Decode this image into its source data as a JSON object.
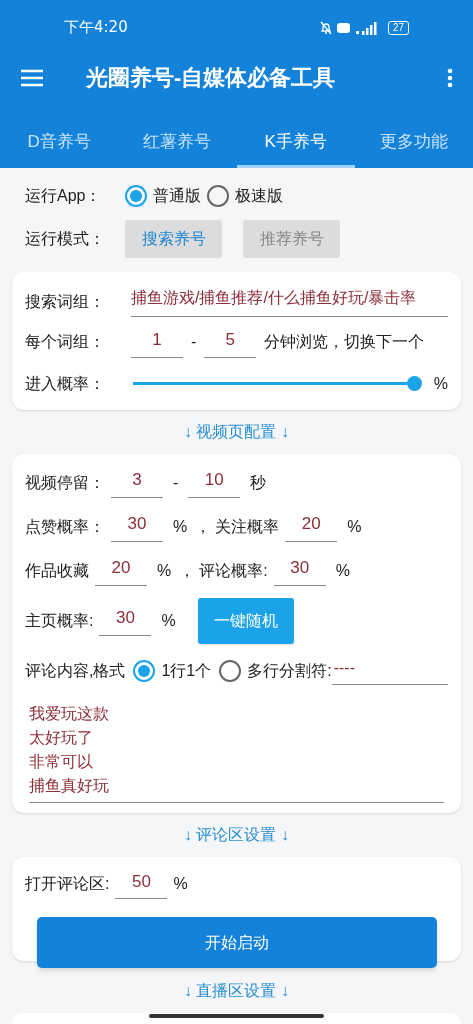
{
  "status_bar": {
    "time": "下午4:20",
    "battery": "27"
  },
  "app_bar": {
    "title": "光圈养号-自媒体必备工具"
  },
  "tabs": [
    {
      "label": "D音养号",
      "selected": false
    },
    {
      "label": "红薯养号",
      "selected": false
    },
    {
      "label": "K手养号",
      "selected": true
    },
    {
      "label": "更多功能",
      "selected": false
    }
  ],
  "run_app": {
    "label": "运行App：",
    "options": [
      {
        "label": "普通版",
        "selected": true
      },
      {
        "label": "极速版",
        "selected": false
      }
    ]
  },
  "run_mode": {
    "label": "运行模式：",
    "buttons": [
      {
        "label": "搜索养号",
        "selected": true
      },
      {
        "label": "推荐养号",
        "selected": false
      }
    ]
  },
  "search_card": {
    "keywords_label": "搜索词组：",
    "keywords": "捕鱼游戏/捕鱼推荐/什么捕鱼好玩/暴击率",
    "per_group_label": "每个词组：",
    "min": "1",
    "dash": "-",
    "max": "5",
    "per_group_suffix": "分钟浏览，切换下一个",
    "enter_label": "进入概率：",
    "enter_slider": {
      "level": 1.0
    },
    "enter_unit": "%"
  },
  "video_header": "↓ 视频页配置 ↓",
  "video_rows": [
    [
      {
        "kind": "label",
        "text": "视频停留："
      },
      {
        "kind": "field",
        "text": "3"
      },
      {
        "kind": "text",
        "text": "-"
      },
      {
        "kind": "field",
        "text": "10"
      },
      {
        "kind": "text",
        "text": "秒"
      }
    ],
    [
      {
        "kind": "label",
        "text": "点赞概率："
      },
      {
        "kind": "field",
        "text": "30"
      },
      {
        "kind": "text",
        "text": "%"
      },
      {
        "kind": "text",
        "text": "，"
      },
      {
        "kind": "label",
        "text": "关注概率"
      },
      {
        "kind": "field",
        "text": "20"
      },
      {
        "kind": "text",
        "text": "%"
      }
    ],
    [
      {
        "kind": "label",
        "text": "作品收藏"
      },
      {
        "kind": "field",
        "text": "20"
      },
      {
        "kind": "text",
        "text": "%"
      },
      {
        "kind": "text",
        "text": "，"
      },
      {
        "kind": "label",
        "text": "评论概率:"
      },
      {
        "kind": "field",
        "text": "30"
      },
      {
        "kind": "text",
        "text": "%"
      }
    ],
    [
      {
        "kind": "label",
        "text": "主页概率:"
      },
      {
        "kind": "field",
        "text": "30"
      },
      {
        "kind": "text",
        "text": "%"
      },
      {
        "kind": "button",
        "text": "一键随机"
      }
    ],
    [
      {
        "kind": "label",
        "text": "评论内容,格式"
      },
      {
        "kind": "radio",
        "text": "1行1个",
        "selected": true
      },
      {
        "kind": "radio",
        "text": "多行分割符:",
        "selected": false
      },
      {
        "kind": "wide_field",
        "text": "----"
      }
    ]
  ],
  "comments": [
    "我爱玩这款",
    "太好玩了",
    "非常可以",
    "捕鱼真好玩"
  ],
  "comment_header": "↓ 评论区设置 ↓",
  "comment_card": {
    "open_label": "打开评论区:",
    "open_value": "50",
    "open_unit": "%"
  },
  "start_button": "开始启动",
  "live_header": "↓ 直播区设置 ↓"
}
